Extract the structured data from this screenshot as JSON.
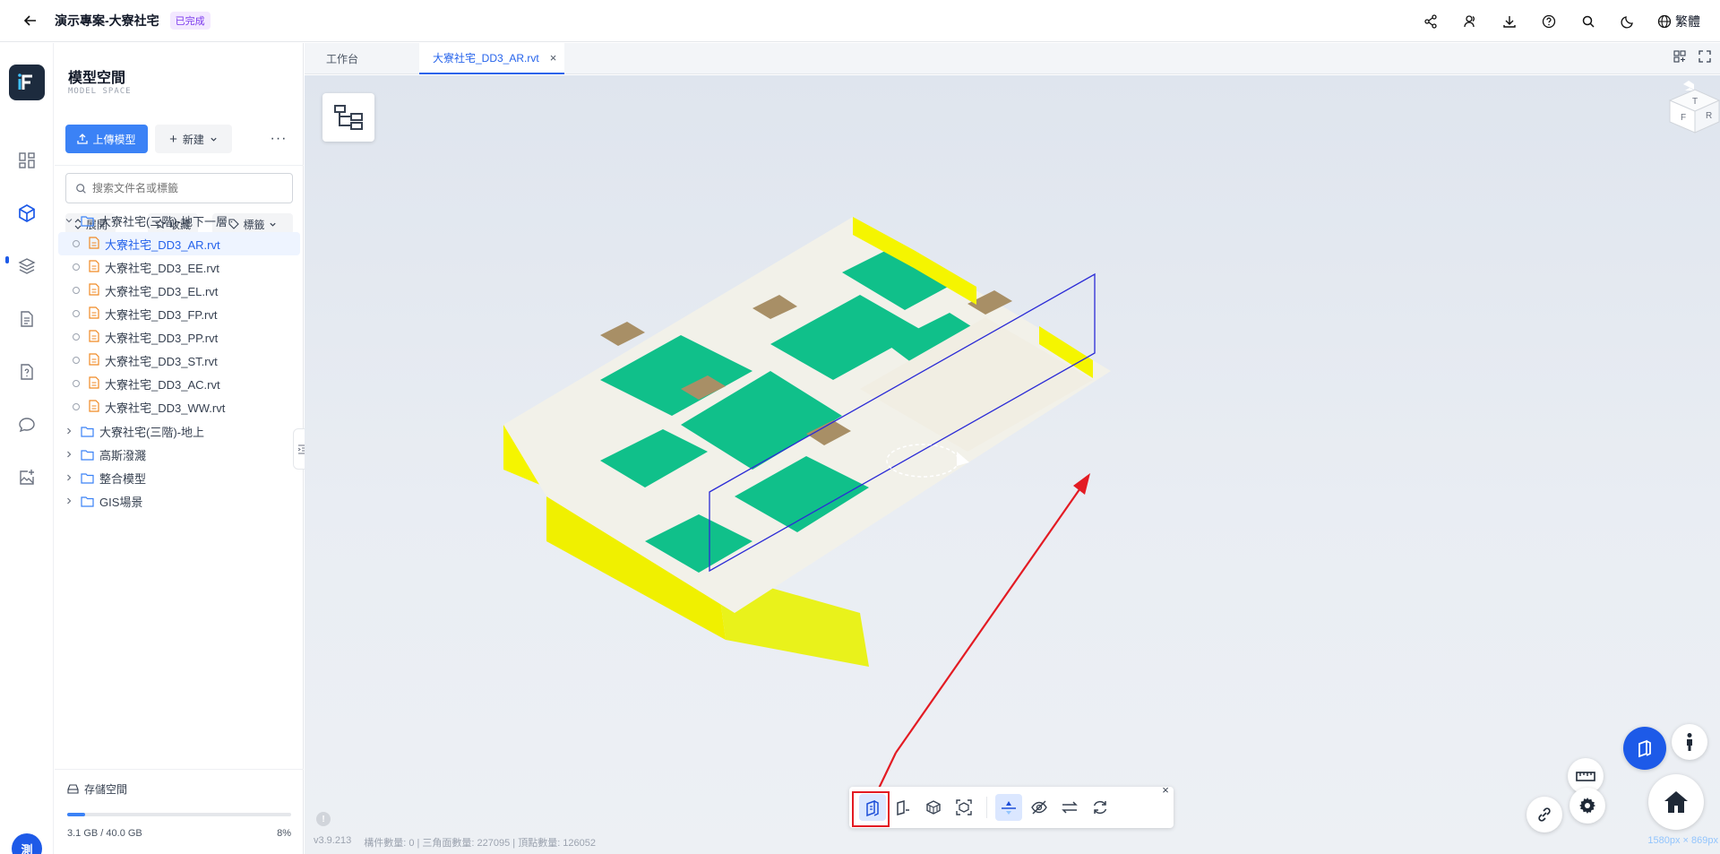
{
  "header": {
    "back_icon": "arrow-left-icon",
    "project_title": "演示專案-大寮社宅",
    "status_badge": "已完成",
    "actions": [
      "share-icon",
      "users-icon",
      "download-icon",
      "help-icon",
      "search-icon",
      "moon-icon"
    ],
    "language": "繁體"
  },
  "rail": {
    "items": [
      "dashboard-icon",
      "cube-icon",
      "layers-icon",
      "document-icon",
      "question-doc-icon",
      "chat-icon",
      "image-add-icon"
    ],
    "active": "cube-icon",
    "user_initial": "測"
  },
  "panel": {
    "title": "模型空間",
    "subtitle": "MODEL SPACE",
    "upload_label": "上傳模型",
    "new_label": "新建",
    "more_label": "···",
    "search_placeholder": "搜索文件名或標籤",
    "filters": {
      "expand": "展開",
      "favorite": "收藏",
      "tag": "標籤"
    },
    "tree": [
      {
        "label": "大寮社宅(三階)-地下一層",
        "type": "folder",
        "expanded": true
      },
      {
        "label": "大寮社宅_DD3_AR.rvt",
        "type": "file",
        "selected": true
      },
      {
        "label": "大寮社宅_DD3_EE.rvt",
        "type": "file"
      },
      {
        "label": "大寮社宅_DD3_EL.rvt",
        "type": "file"
      },
      {
        "label": "大寮社宅_DD3_FP.rvt",
        "type": "file"
      },
      {
        "label": "大寮社宅_DD3_PP.rvt",
        "type": "file"
      },
      {
        "label": "大寮社宅_DD3_ST.rvt",
        "type": "file"
      },
      {
        "label": "大寮社宅_DD3_AC.rvt",
        "type": "file"
      },
      {
        "label": "大寮社宅_DD3_WW.rvt",
        "type": "file"
      },
      {
        "label": "大寮社宅(三階)-地上",
        "type": "folder",
        "expanded": false
      },
      {
        "label": "高斯潑濺",
        "type": "folder",
        "expanded": false
      },
      {
        "label": "整合模型",
        "type": "folder",
        "expanded": false
      },
      {
        "label": "GIS場景",
        "type": "folder",
        "expanded": false
      }
    ],
    "storage": {
      "label": "存儲空間",
      "used": "3.1 GB / 40.0 GB",
      "percent_label": "8%",
      "percent": 0.08
    }
  },
  "tabs": [
    {
      "label": "工作台",
      "active": false
    },
    {
      "label": "大寮社宅_DD3_AR.rvt",
      "active": true,
      "closable": true
    }
  ],
  "viewport": {
    "status": {
      "version": "v3.9.213",
      "stats": "構件數量: 0 | 三角面數量: 227095 | 頂點數量: 126052"
    },
    "resolution": "1580px × 869px",
    "toolbar_close": "×",
    "warn_glyph": "!",
    "toolbar": [
      "section-box-icon",
      "section-plane-icon",
      "explode-icon",
      "isolate-icon",
      "pick-plane-icon",
      "hide-icon",
      "swap-icon",
      "reset-icon"
    ],
    "viewcube_faces": {
      "top": "T",
      "front": "F",
      "right": "R"
    },
    "colors": {
      "accent": "#1d5ae8",
      "highlight": "#e31b23",
      "floor_green": "#10c08a",
      "wall_yellow": "#f5f500",
      "section_plane": "#2b2bd6"
    }
  }
}
